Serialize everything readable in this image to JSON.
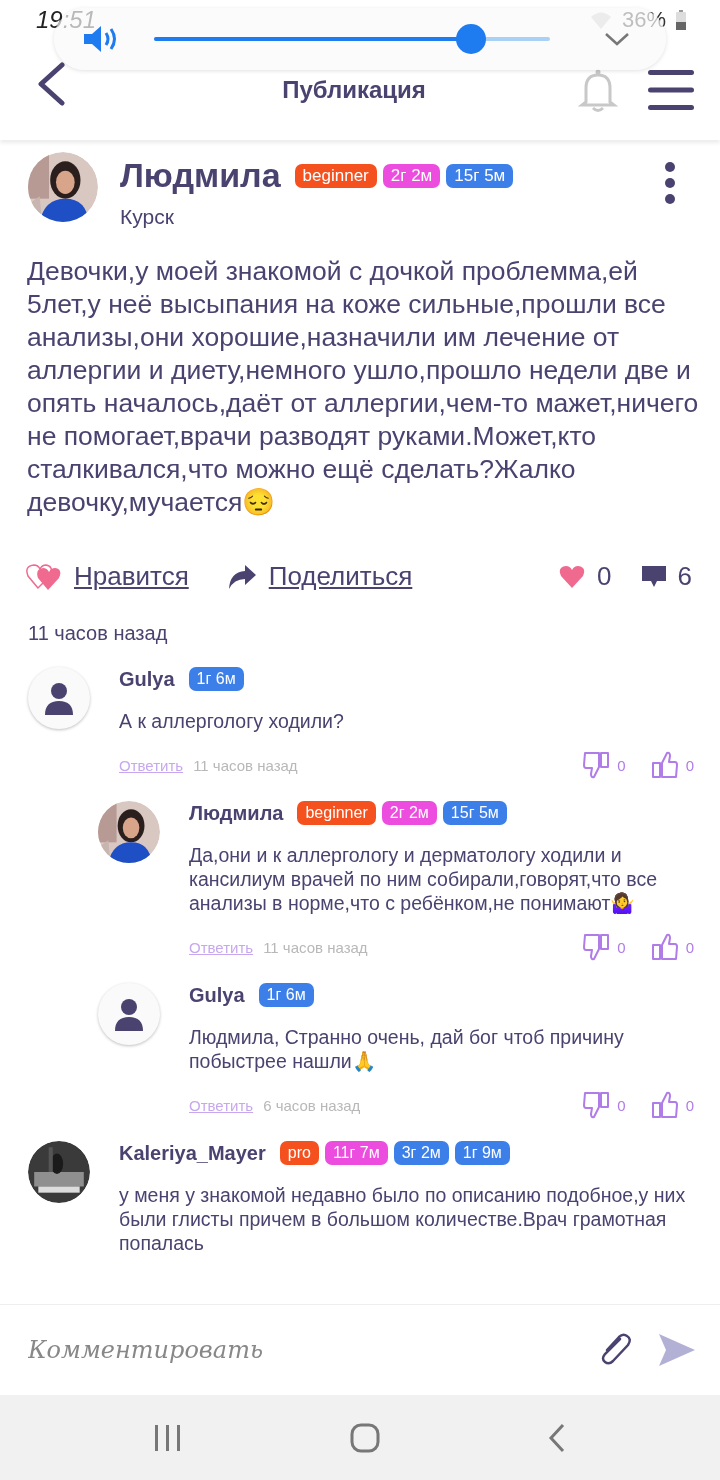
{
  "status_bar": {
    "time": "19:51",
    "battery": "36%"
  },
  "volume": {
    "level": 0.8
  },
  "header": {
    "title": "Публикация"
  },
  "post": {
    "author": "Людмила",
    "city": "Курск",
    "badges": [
      {
        "label": "beginner",
        "color": "#f4511e"
      },
      {
        "label": "2г 2м",
        "color": "#ec4ddf"
      },
      {
        "label": "15г 5м",
        "color": "#3d7fe8"
      }
    ],
    "text": "Девочки,у моей знакомой с дочкой проблемма,ей 5лет,у неё высыпания на коже сильные,прошли все анализы,они хорошие,назначили им лечение от аллергии и диету,немного ушло,прошло недели две и опять началось,даёт от аллергии,чем-то мажет,ничего не помогает,врачи разводят руками.Может,кто сталкивался,что можно ещё сделать?Жалко девочку,мучается😔",
    "like_label": "Нравится",
    "share_label": "Поделиться",
    "likes": "0",
    "comments": "6",
    "time": "11 часов назад"
  },
  "comments": [
    {
      "author": "Gulya",
      "avatar": {
        "kind": "placeholder"
      },
      "badges": [
        {
          "label": "1г 6м",
          "color": "#3d7fe8"
        }
      ],
      "text": "А к аллергологу ходили?",
      "reply_label": "Ответить",
      "time": "11 часов назад",
      "dislikes": "0",
      "likes": "0",
      "children": [
        {
          "author": "Людмила",
          "avatar": {
            "kind": "portrait"
          },
          "badges": [
            {
              "label": "beginner",
              "color": "#f4511e"
            },
            {
              "label": "2г 2м",
              "color": "#ec4ddf"
            },
            {
              "label": "15г 5м",
              "color": "#3d7fe8"
            }
          ],
          "text": "Да,они и к аллергологу и дерматологу ходили и кансилиум врачей по ним собирали,говорят,что все анализы в норме,что с ребёнком,не понимают🤷‍♀️",
          "reply_label": "Ответить",
          "time": "11 часов назад",
          "dislikes": "0",
          "likes": "0"
        },
        {
          "author": "Gulya",
          "avatar": {
            "kind": "placeholder"
          },
          "badges": [
            {
              "label": "1г 6м",
              "color": "#3d7fe8"
            }
          ],
          "text": "Людмила, Странно очень, дай бог чтоб причину побыстрее нашли🙏",
          "reply_label": "Ответить",
          "time": "6 часов назад",
          "dislikes": "0",
          "likes": "0"
        }
      ]
    },
    {
      "author": "Kaleriya_Mayer",
      "badges": [
        {
          "label": "pro",
          "color": "#f4511e"
        },
        {
          "label": "11г 7м",
          "color": "#ec4ddf"
        },
        {
          "label": "3г 2м",
          "color": "#3d7fe8"
        },
        {
          "label": "1г 9м",
          "color": "#3d7fe8"
        }
      ],
      "text": "у меня у знакомой недавно было по описанию подобное,у них были глисты причем в большом количестве.Врач грамотная попалась"
    }
  ],
  "composer": {
    "placeholder": "Комментировать"
  }
}
